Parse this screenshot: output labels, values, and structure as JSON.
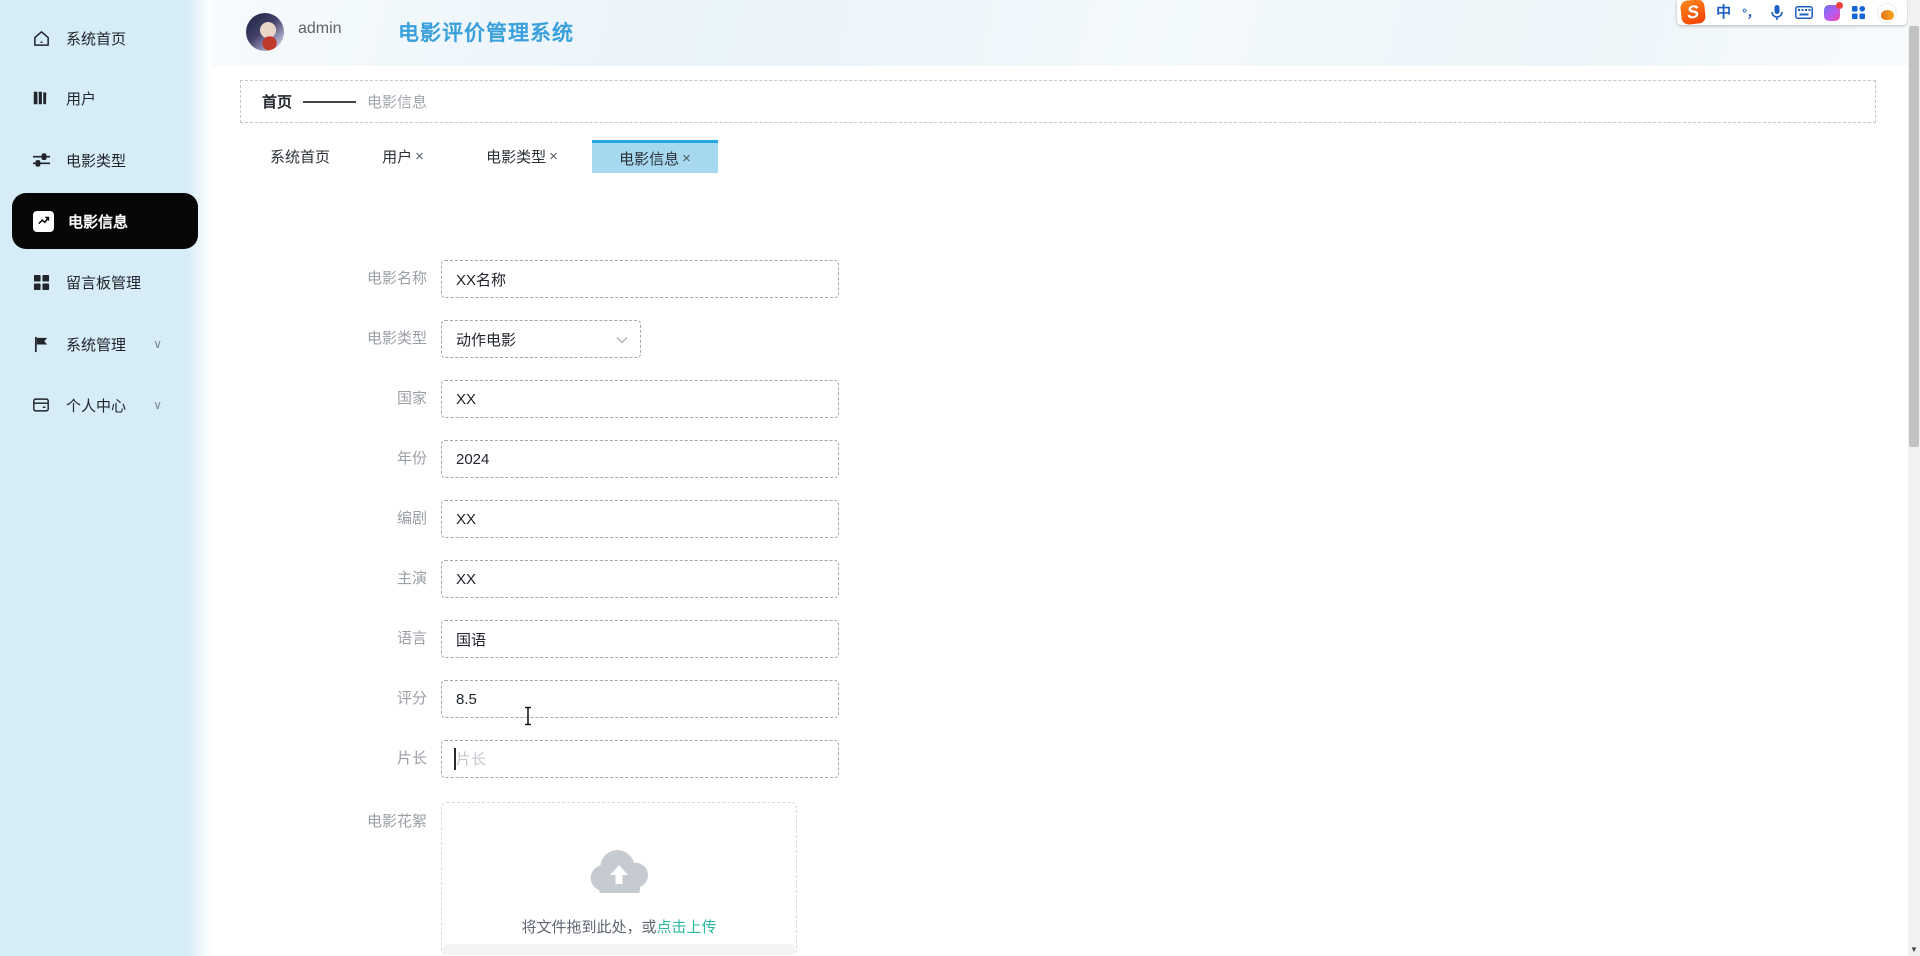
{
  "app": {
    "title": "电影评价管理系统",
    "username": "admin"
  },
  "sidebar": {
    "items": [
      {
        "label": "系统首页",
        "icon": "home-icon"
      },
      {
        "label": "用户",
        "icon": "library-icon"
      },
      {
        "label": "电影类型",
        "icon": "sliders-icon"
      },
      {
        "label": "电影信息",
        "icon": "trend-chart-icon",
        "active": true
      },
      {
        "label": "留言板管理",
        "icon": "grid-icon"
      },
      {
        "label": "系统管理",
        "icon": "flag-icon",
        "chevron": "∨"
      },
      {
        "label": "个人中心",
        "icon": "card-icon",
        "chevron": "∨"
      }
    ]
  },
  "breadcrumb": {
    "home": "首页",
    "current": "电影信息"
  },
  "tabs": [
    {
      "label": "系统首页"
    },
    {
      "label": "用户",
      "close": "×"
    },
    {
      "label": "电影类型",
      "close": "×"
    },
    {
      "label": "电影信息",
      "close": "×",
      "active": true
    }
  ],
  "form": {
    "fields": [
      {
        "label": "电影名称",
        "value": "XX名称"
      },
      {
        "label": "电影类型",
        "value": "动作电影",
        "type": "select"
      },
      {
        "label": "国家",
        "value": "XX"
      },
      {
        "label": "年份",
        "value": "2024"
      },
      {
        "label": "编剧",
        "value": "XX"
      },
      {
        "label": "主演",
        "value": "XX"
      },
      {
        "label": "语言",
        "value": "国语"
      },
      {
        "label": "评分",
        "value": "8.5"
      },
      {
        "label": "片长",
        "placeholder": "片长"
      }
    ],
    "upload": {
      "label": "电影花絮",
      "drag_text": "将文件拖到此处，或",
      "link_text": "点击上传"
    }
  },
  "ime_toolbar": {
    "logo": "S",
    "lang_mode": "中",
    "punct": "°，"
  },
  "scrollbar": {
    "down_arrow": "▼"
  },
  "colors": {
    "title_blue": "#3aa0dc",
    "sidebar_bg": "#d6ecf7",
    "active_item_bg": "#070708",
    "tab_active_bg": "#a6d8ef",
    "tab_active_border": "#23a8e0",
    "upload_link_teal": "#2eb8a0"
  }
}
